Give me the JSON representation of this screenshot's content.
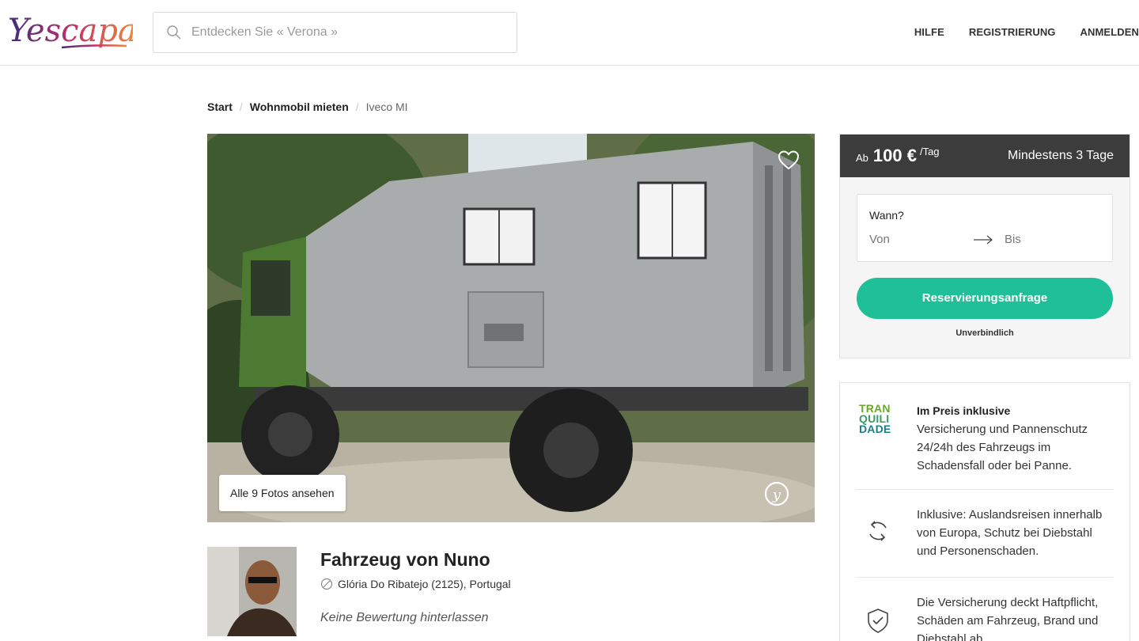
{
  "header": {
    "logo_text": "Yescapa",
    "search_placeholder": "Entdecken Sie « Verona »",
    "nav": [
      "HILFE",
      "REGISTRIERUNG",
      "ANMELDEN"
    ]
  },
  "breadcrumb": {
    "items": [
      "Start",
      "Wohnmobil mieten"
    ],
    "current": "Iveco MI"
  },
  "gallery": {
    "see_all_label": "Alle 9 Fotos ansehen"
  },
  "owner": {
    "name": "Fahrzeug von Nuno",
    "location": "Glória Do Ribatejo (2125), Portugal",
    "rating": "Keine Bewertung hinterlassen"
  },
  "booking": {
    "price_prefix": "Ab",
    "price": "100 €",
    "price_unit": "/Tag",
    "minimum": "Mindestens 3 Tage",
    "when_label": "Wann?",
    "from_placeholder": "Von",
    "to_placeholder": "Bis",
    "reserve_label": "Reservierungsanfrage",
    "nonbinding_label": "Unverbindlich"
  },
  "insurance": {
    "badge_lines": [
      "TRAN",
      "QUILI",
      "DADE"
    ],
    "included_title": "Im Preis inklusive",
    "included_text": "Versicherung und Pannenschutz 24/24h des Fahrzeugs im Schadensfall oder bei Panne.",
    "abroad_text": "Inklusive: Auslandsreisen innerhalb von Europa, Schutz bei Diebstahl und Personenschaden.",
    "coverage_text": "Die Versicherung deckt Haftpflicht, Schäden am Fahrzeug, Brand und Diebstahl ab."
  },
  "colors": {
    "accent": "#1fbf98",
    "price_bar": "#3c3c3c",
    "badge_green": "#6aa82a",
    "badge_teal": "#1a7f86"
  }
}
